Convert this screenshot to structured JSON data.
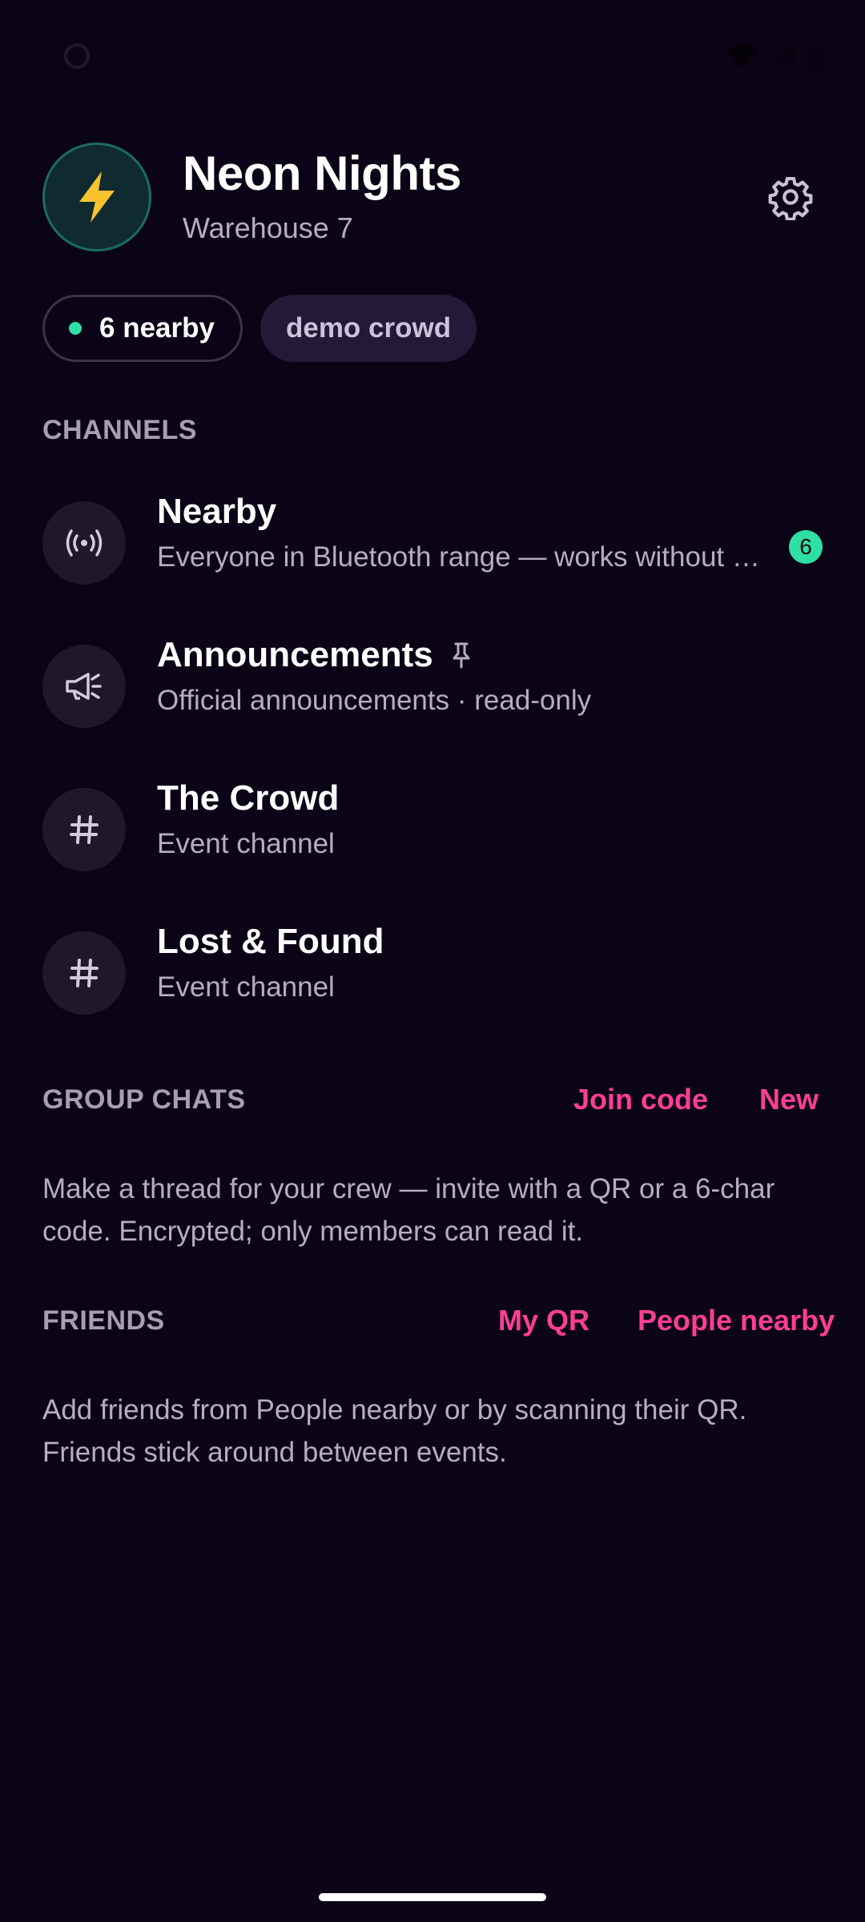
{
  "event": {
    "title": "Neon Nights",
    "venue": "Warehouse 7"
  },
  "chips": {
    "nearby_label": "6 nearby",
    "demo_label": "demo crowd"
  },
  "channels_section": {
    "label": "CHANNELS",
    "items": [
      {
        "name": "Nearby",
        "description": "Everyone in Bluetooth range — works without …",
        "icon": "broadcast-icon",
        "badge": "6"
      },
      {
        "name": "Announcements",
        "description": "Official announcements · read-only",
        "icon": "megaphone-icon",
        "pinned": true
      },
      {
        "name": "The Crowd",
        "description": "Event channel",
        "icon": "hash-icon"
      },
      {
        "name": "Lost & Found",
        "description": "Event channel",
        "icon": "hash-icon"
      }
    ]
  },
  "group_chats": {
    "label": "GROUP CHATS",
    "join_code_label": "Join code",
    "new_label": "New",
    "empty_text": "Make a thread for your crew — invite with a QR or a 6-char code. Encrypted; only members can read it."
  },
  "friends": {
    "label": "FRIENDS",
    "my_qr_label": "My QR",
    "people_nearby_label": "People nearby",
    "empty_text": "Add friends from People nearby or by scanning their QR. Friends stick around between events."
  },
  "colors": {
    "background": "#0b0416",
    "accent": "#ff3e95",
    "online": "#2fe0a4"
  }
}
